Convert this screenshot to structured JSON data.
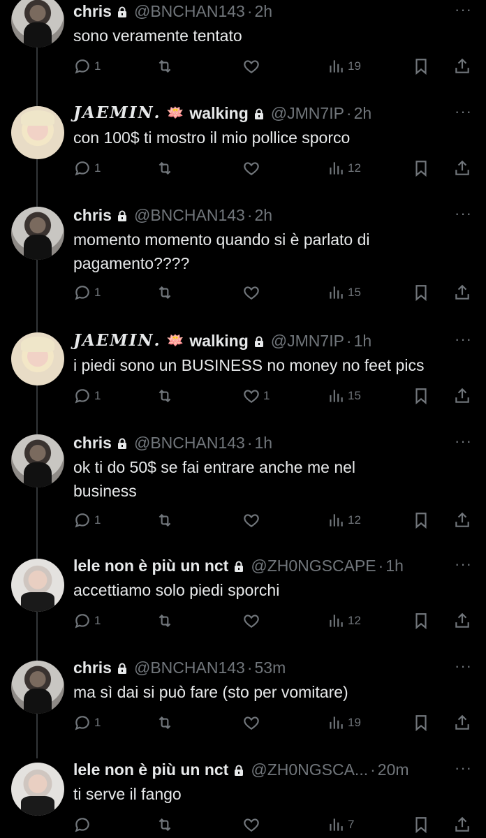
{
  "tweets": [
    {
      "author_type": "chris",
      "display_name": "chris",
      "handle": "@BNCHAN143",
      "time": "2h",
      "text": "sono veramente tentato",
      "replies": "1",
      "likes": "",
      "views": "19"
    },
    {
      "author_type": "jaemin",
      "display_name": "𝑱𝑨𝑬𝑴𝑰𝑵.",
      "emoji": "🪷",
      "status": "walking",
      "handle": "@JMN7IP",
      "time": "2h",
      "text": "con 100$ ti mostro il mio pollice sporco",
      "replies": "1",
      "likes": "",
      "views": "12"
    },
    {
      "author_type": "chris",
      "display_name": "chris",
      "handle": "@BNCHAN143",
      "time": "2h",
      "text": "momento momento quando si è parlato di pagamento????",
      "replies": "1",
      "likes": "",
      "views": "15"
    },
    {
      "author_type": "jaemin",
      "display_name": "𝑱𝑨𝑬𝑴𝑰𝑵.",
      "emoji": "🪷",
      "status": "walking",
      "handle": "@JMN7IP",
      "time": "1h",
      "text": "i piedi sono un BUSINESS no money no feet pics",
      "replies": "1",
      "likes": "1",
      "views": "15"
    },
    {
      "author_type": "chris",
      "display_name": "chris",
      "handle": "@BNCHAN143",
      "time": "1h",
      "text": "ok ti do 50$ se fai entrare anche me nel business",
      "replies": "1",
      "likes": "",
      "views": "12"
    },
    {
      "author_type": "lele",
      "display_name": "lele non è più un nct",
      "handle": "@ZH0NGSCAPE",
      "time": "1h",
      "text": "accettiamo solo piedi sporchi",
      "replies": "1",
      "likes": "",
      "views": "12"
    },
    {
      "author_type": "chris",
      "display_name": "chris",
      "handle": "@BNCHAN143",
      "time": "53m",
      "text": "ma sì dai si può fare (sto per vomitare)",
      "replies": "1",
      "likes": "",
      "views": "19"
    },
    {
      "author_type": "lele",
      "display_name": "lele non è più un nct",
      "handle": "@ZH0NGSCA...",
      "time": "20m",
      "text": "ti serve il fango",
      "replies": "",
      "likes": "",
      "views": "7"
    }
  ],
  "icons": {
    "more": "more-horizontal-icon",
    "lock": "lock-icon",
    "reply": "reply-icon",
    "retweet": "retweet-icon",
    "like": "heart-icon",
    "views": "views-icon",
    "bookmark": "bookmark-icon",
    "share": "share-icon"
  },
  "colors": {
    "background": "#000000",
    "text": "#e7e9ea",
    "muted": "#71767b",
    "line": "#333639"
  }
}
